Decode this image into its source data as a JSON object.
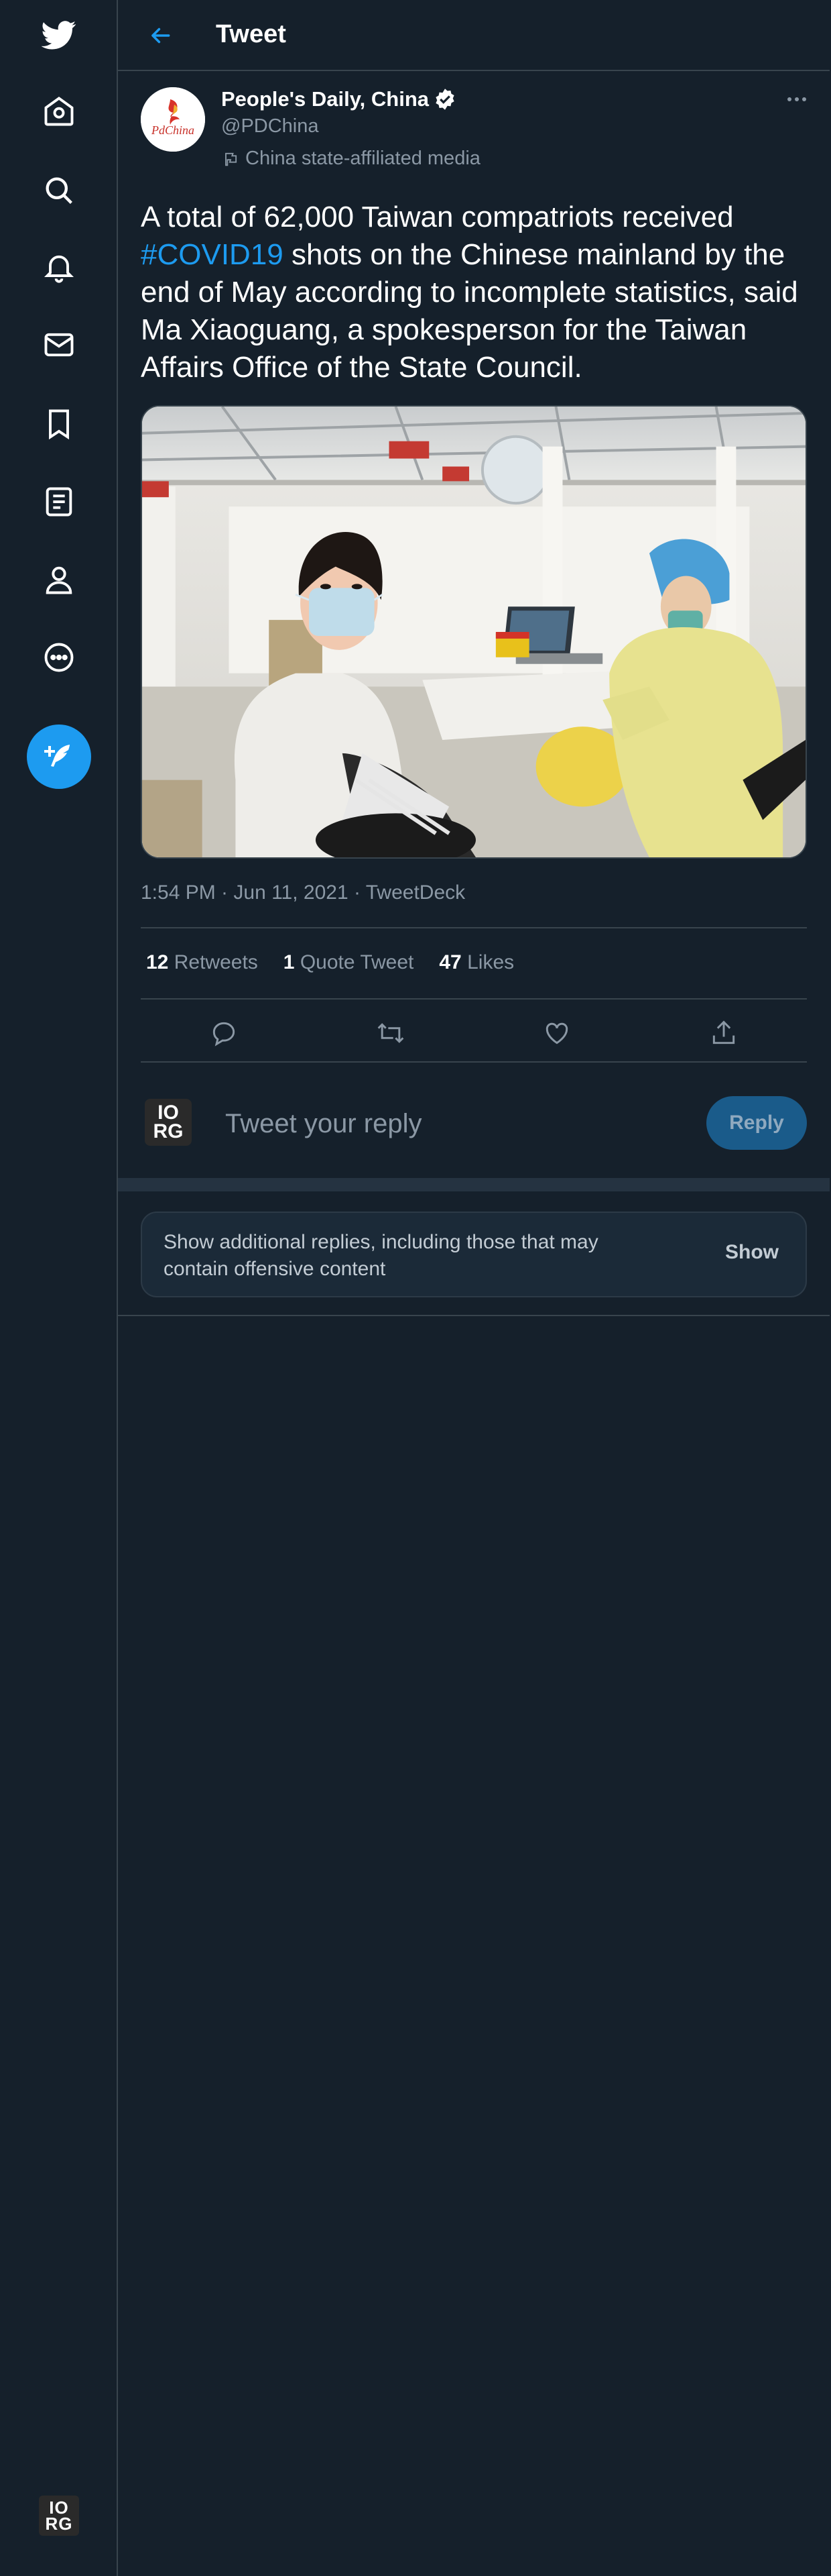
{
  "nav": {
    "items": [
      "twitter-logo",
      "home",
      "explore",
      "notifications",
      "messages",
      "bookmarks",
      "lists",
      "profile",
      "more"
    ],
    "account_avatar_text": "IO RG"
  },
  "header": {
    "title": "Tweet"
  },
  "tweet": {
    "author_name": "People's Daily, China",
    "handle": "@PDChina",
    "label": "China state-affiliated media",
    "text_before": "A total of 62,000 Taiwan compatriots received ",
    "hashtag": "#COVID19",
    "text_after": " shots on the Chinese mainland by the end of May according to incomplete statistics, said Ma Xiaoguang, a spokesperson for the Taiwan Affairs Office of the State Council.",
    "timestamp": "1:54 PM · Jun 11, 2021 · TweetDeck",
    "retweets_count": "12",
    "retweets_label": "Retweets",
    "quotes_count": "1",
    "quotes_label": "Quote Tweet",
    "likes_count": "47",
    "likes_label": "Likes",
    "avatar_text": "PdChina"
  },
  "reply": {
    "avatar_text": "IO RG",
    "placeholder": "Tweet your reply",
    "button_label": "Reply"
  },
  "more_replies": {
    "text": "Show additional replies, including those that may contain offensive content",
    "button_label": "Show"
  },
  "colors": {
    "background": "#15202b",
    "accent": "#1d9bf0",
    "muted": "#8b98a5",
    "border": "#38444d"
  }
}
